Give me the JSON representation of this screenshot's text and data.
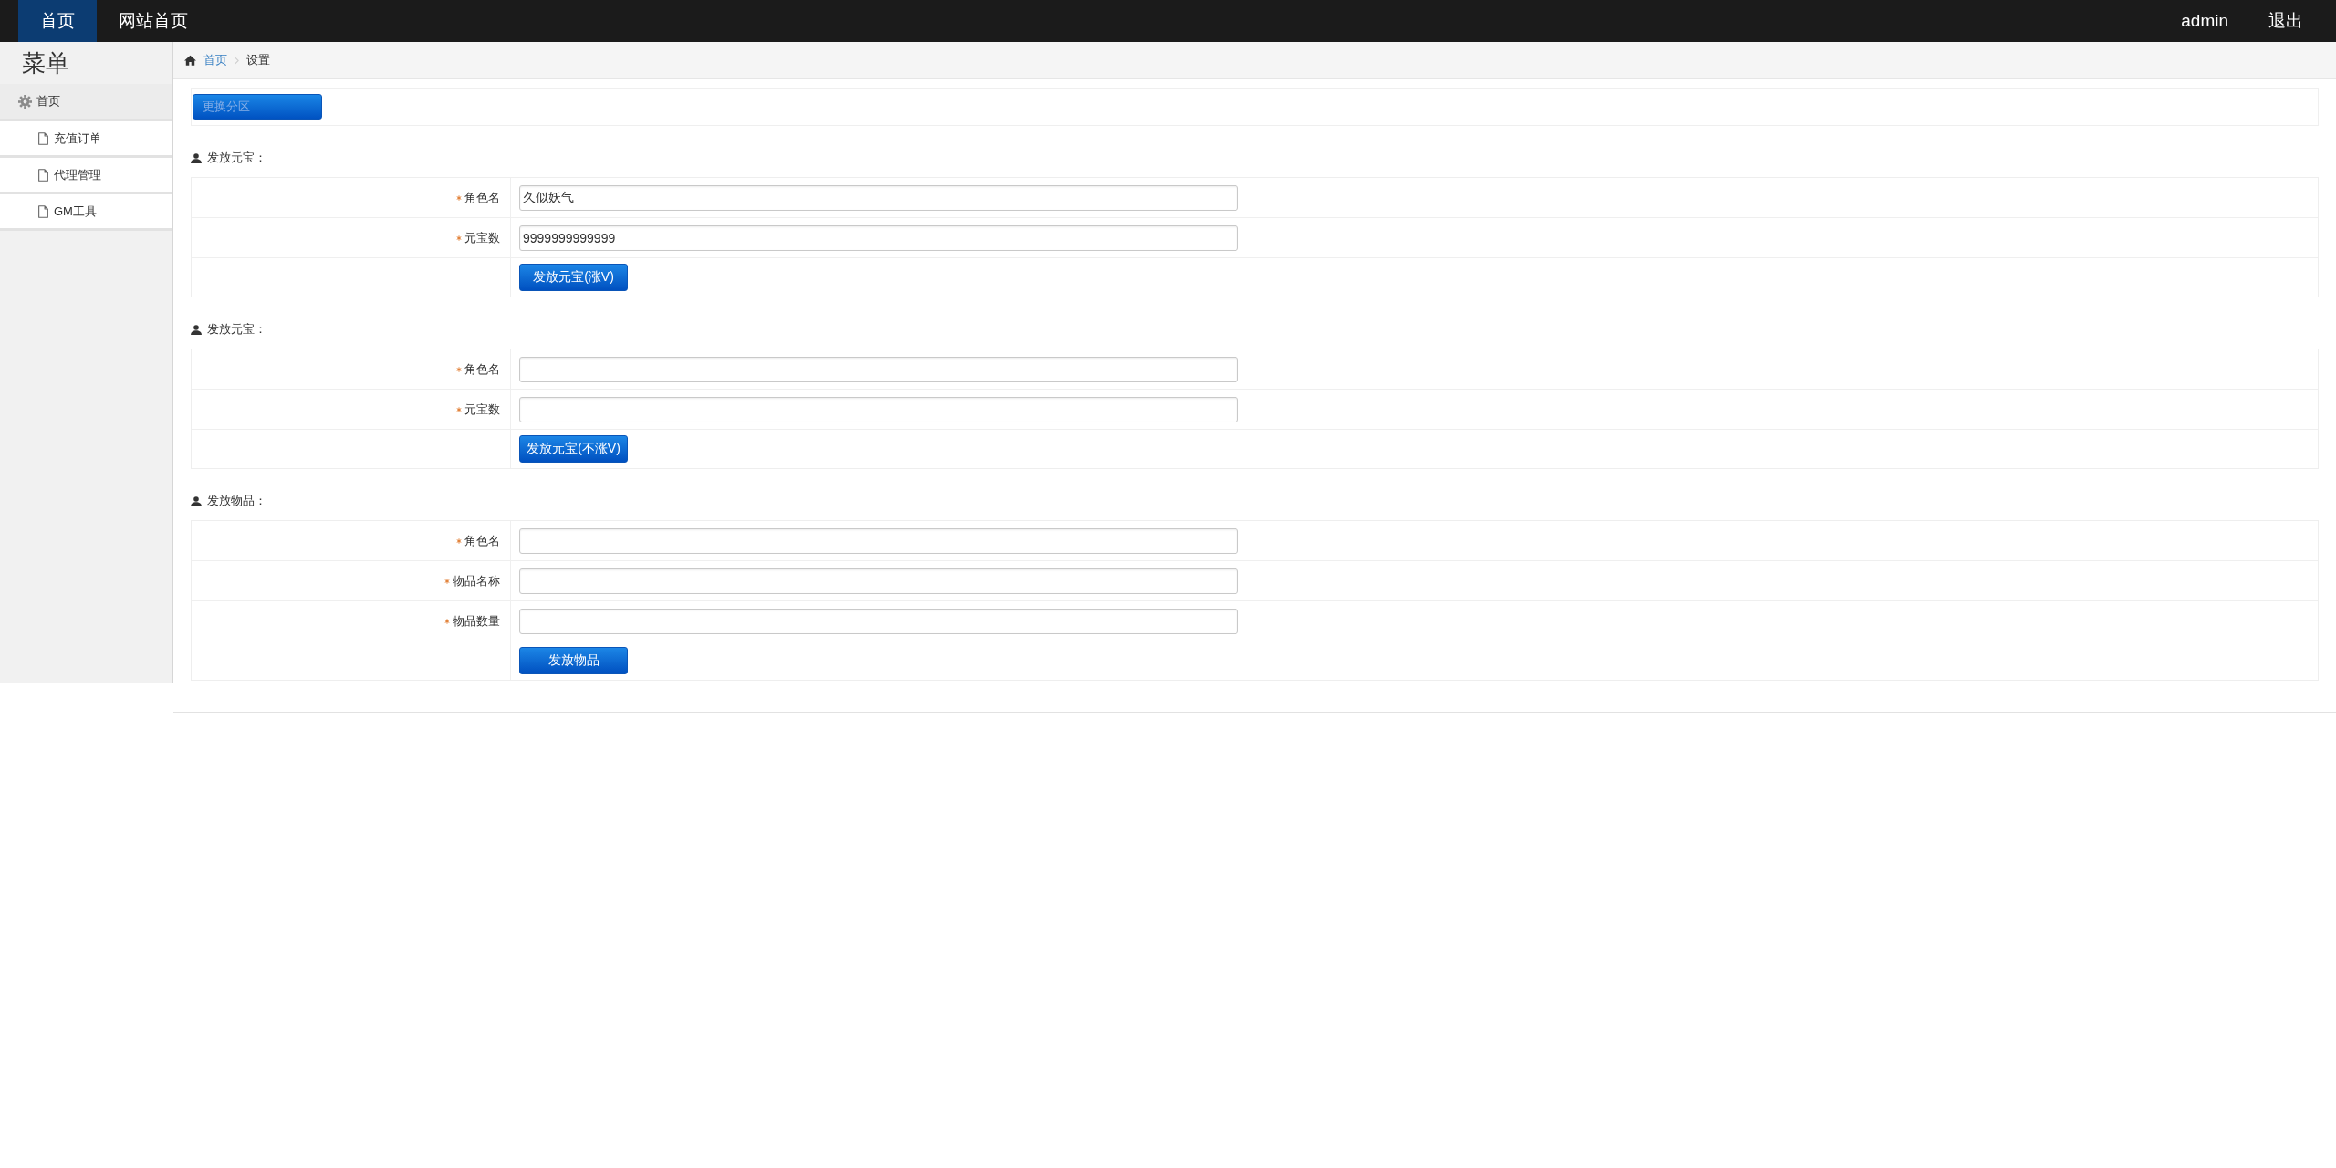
{
  "top_nav": {
    "tabs": [
      {
        "label": "首页",
        "selected": true
      },
      {
        "label": "网站首页",
        "selected": false
      }
    ],
    "user": "admin",
    "logout": "退出"
  },
  "sidebar": {
    "title": "菜单",
    "items": [
      {
        "label": "首页",
        "children": [
          {
            "label": "充值订单"
          },
          {
            "label": "代理管理"
          },
          {
            "label": "GM工具"
          }
        ]
      }
    ]
  },
  "breadcrumb": [
    {
      "label": "首页",
      "kind": "link"
    },
    {
      "label": "设置",
      "kind": "current"
    }
  ],
  "zone_button": "更换分区",
  "sections": [
    {
      "title": "发放元宝：",
      "fields": [
        {
          "label": "角色名",
          "required": true,
          "value": "久似妖气"
        },
        {
          "label": "元宝数",
          "required": true,
          "value": "9999999999999"
        }
      ],
      "button": "发放元宝(涨V)"
    },
    {
      "title": "发放元宝：",
      "fields": [
        {
          "label": "角色名",
          "required": true
        },
        {
          "label": "元宝数",
          "required": true
        }
      ],
      "button": "发放元宝(不涨V)"
    },
    {
      "title": "发放物品：",
      "fields": [
        {
          "label": "角色名",
          "required": true
        },
        {
          "label": "物品名称",
          "required": true
        },
        {
          "label": "物品数量",
          "required": true
        }
      ],
      "button": "发放物品"
    }
  ]
}
